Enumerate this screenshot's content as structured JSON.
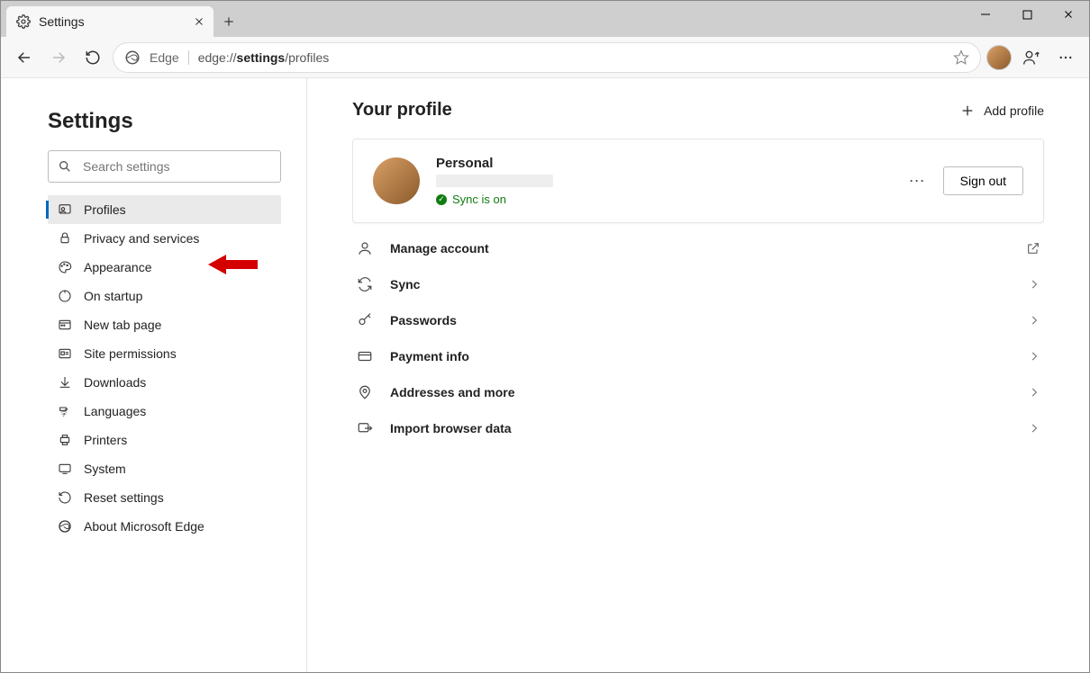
{
  "tab": {
    "title": "Settings"
  },
  "addressbar": {
    "label": "Edge",
    "url_prefix": "edge://",
    "url_bold": "settings",
    "url_suffix": "/profiles"
  },
  "sidebar": {
    "title": "Settings",
    "search_placeholder": "Search settings",
    "items": [
      {
        "label": "Profiles",
        "active": true
      },
      {
        "label": "Privacy and services"
      },
      {
        "label": "Appearance"
      },
      {
        "label": "On startup"
      },
      {
        "label": "New tab page"
      },
      {
        "label": "Site permissions"
      },
      {
        "label": "Downloads"
      },
      {
        "label": "Languages"
      },
      {
        "label": "Printers"
      },
      {
        "label": "System"
      },
      {
        "label": "Reset settings"
      },
      {
        "label": "About Microsoft Edge"
      }
    ]
  },
  "main": {
    "heading": "Your profile",
    "add_profile": "Add profile",
    "profile": {
      "name": "Personal",
      "sync_status": "Sync is on",
      "signout": "Sign out"
    },
    "rows": [
      {
        "label": "Manage account",
        "external": true
      },
      {
        "label": "Sync"
      },
      {
        "label": "Passwords"
      },
      {
        "label": "Payment info"
      },
      {
        "label": "Addresses and more"
      },
      {
        "label": "Import browser data"
      }
    ]
  }
}
